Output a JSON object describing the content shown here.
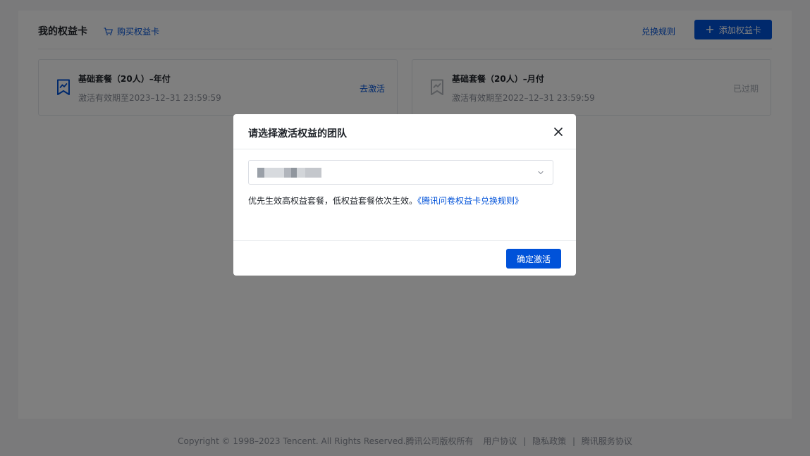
{
  "header": {
    "title": "我的权益卡",
    "buy_label": "购买权益卡",
    "rules_label": "兑换规则",
    "add_label": "添加权益卡"
  },
  "cards": [
    {
      "name": "基础套餐（20人）–年付",
      "validity": "激活有效期至2023–12–31 23:59:59",
      "action": "去激活"
    },
    {
      "name": "基础套餐（20人）–月付",
      "validity": "激活有效期至2022–12–31 23:59:59",
      "action": "已过期"
    }
  ],
  "footer": {
    "copyright": "Copyright © 1998–2023 Tencent. All Rights Reserved.腾讯公司版权所有",
    "links": [
      "用户协议",
      "隐私政策",
      "腾讯服务协议"
    ]
  },
  "modal": {
    "title": "请选择激活权益的团队",
    "hint": "优先生效高权益套餐，低权益套餐依次生效。",
    "hint_link": "《腾讯问卷权益卡兑换规则》",
    "confirm_label": "确定激活"
  },
  "colors": {
    "primary": "#0052d9",
    "muted": "#8a8f99",
    "mask": "rgba(0,0,0,0.5)"
  },
  "icons": {
    "cart": "cart-icon",
    "bookmark": "bookmark-icon",
    "close": "close-icon",
    "chevron": "chevron-down-icon",
    "plus": "plus-icon"
  }
}
